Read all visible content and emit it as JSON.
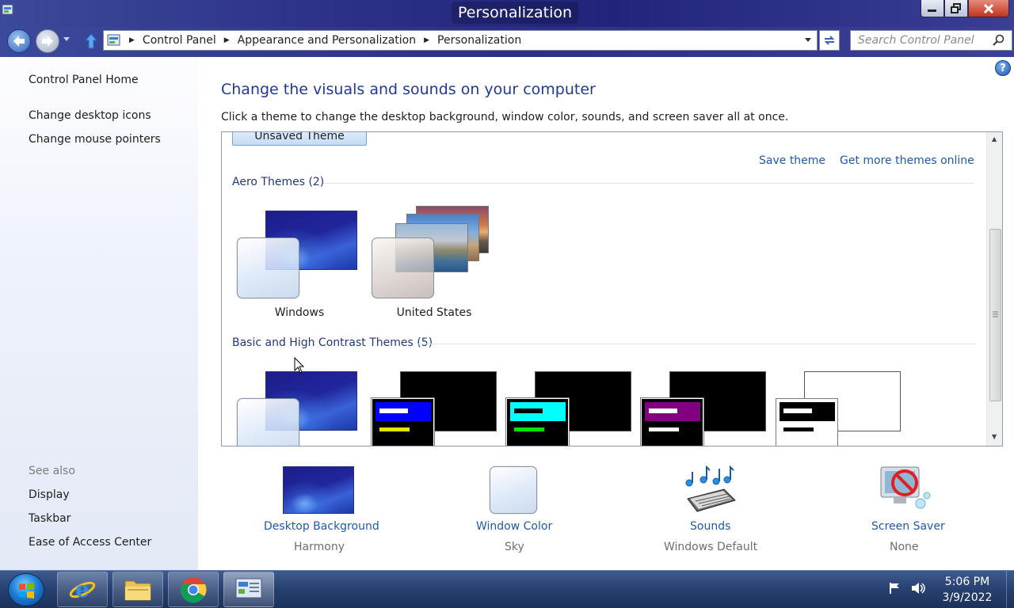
{
  "window": {
    "title": "Personalization"
  },
  "address": {
    "crumbs": [
      "Control Panel",
      "Appearance and Personalization",
      "Personalization"
    ],
    "search_placeholder": "Search Control Panel"
  },
  "sidebar": {
    "links": [
      "Control Panel Home",
      "Change desktop icons",
      "Change mouse pointers"
    ],
    "see_also_label": "See also",
    "see_also": [
      "Display",
      "Taskbar",
      "Ease of Access Center"
    ]
  },
  "main": {
    "heading": "Change the visuals and sounds on your computer",
    "intro": "Click a theme to change the desktop background, window color, sounds, and screen saver all at once.",
    "unsaved_theme": "Unsaved Theme",
    "save_theme": "Save theme",
    "get_more": "Get more themes online",
    "aero_group": "Aero Themes (2)",
    "aero_themes": [
      "Windows",
      "United States"
    ],
    "basic_group": "Basic and High Contrast Themes (5)"
  },
  "bottom": [
    {
      "label": "Desktop Background",
      "value": "Harmony"
    },
    {
      "label": "Window Color",
      "value": "Sky"
    },
    {
      "label": "Sounds",
      "value": "Windows Default"
    },
    {
      "label": "Screen Saver",
      "value": "None"
    }
  ],
  "taskbar": {
    "time": "5:06 PM",
    "date": "3/9/2022"
  },
  "colors": {
    "link": "#1e5aa8",
    "heading": "#1f3a93",
    "hc1_accent": "#0000ff",
    "hc2_accent": "#00ffff",
    "hc3_accent": "#800080"
  }
}
